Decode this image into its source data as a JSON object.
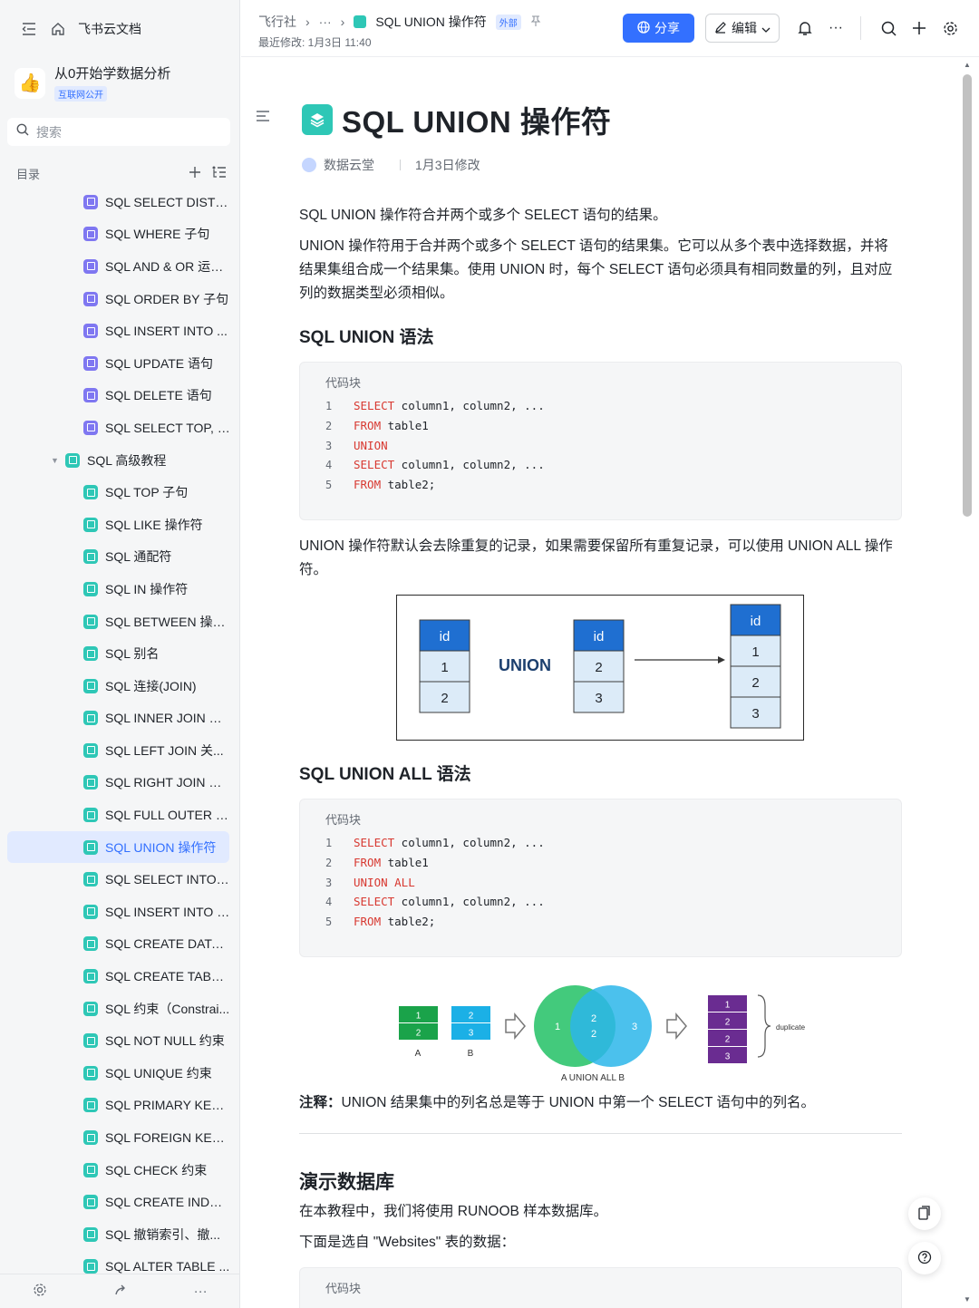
{
  "sidebar": {
    "brand": "飞书云文档",
    "space_name": "从0开始学数据分析",
    "space_badge": "互联网公开",
    "search_placeholder": "搜索",
    "toc_label": "目录",
    "items": [
      {
        "label": "SQL SELECT DISTIN...",
        "color": "purple"
      },
      {
        "label": "SQL WHERE 子句",
        "color": "purple"
      },
      {
        "label": "SQL AND & OR 运算...",
        "color": "purple"
      },
      {
        "label": "SQL ORDER BY 子句",
        "color": "purple"
      },
      {
        "label": "SQL INSERT INTO ...",
        "color": "purple"
      },
      {
        "label": "SQL UPDATE 语句",
        "color": "purple"
      },
      {
        "label": "SQL DELETE 语句",
        "color": "purple"
      },
      {
        "label": "SQL SELECT TOP, LI...",
        "color": "purple"
      },
      {
        "label": "SQL 高级教程",
        "color": "teal",
        "parent": true
      },
      {
        "label": "SQL TOP 子句",
        "color": "teal"
      },
      {
        "label": "SQL LIKE 操作符",
        "color": "teal"
      },
      {
        "label": "SQL 通配符",
        "color": "teal"
      },
      {
        "label": "SQL IN 操作符",
        "color": "teal"
      },
      {
        "label": "SQL BETWEEN 操作符",
        "color": "teal"
      },
      {
        "label": "SQL 别名",
        "color": "teal"
      },
      {
        "label": "SQL 连接(JOIN)",
        "color": "teal"
      },
      {
        "label": "SQL INNER JOIN 关...",
        "color": "teal"
      },
      {
        "label": "SQL LEFT JOIN 关...",
        "color": "teal"
      },
      {
        "label": "SQL RIGHT JOIN 关...",
        "color": "teal"
      },
      {
        "label": "SQL FULL OUTER J...",
        "color": "teal"
      },
      {
        "label": "SQL UNION 操作符",
        "color": "teal",
        "active": true
      },
      {
        "label": "SQL SELECT INTO ...",
        "color": "teal"
      },
      {
        "label": "SQL INSERT INTO S...",
        "color": "teal"
      },
      {
        "label": "SQL CREATE DATAB...",
        "color": "teal"
      },
      {
        "label": "SQL CREATE TABLE ...",
        "color": "teal"
      },
      {
        "label": "SQL 约束（Constrai...",
        "color": "teal"
      },
      {
        "label": "SQL NOT NULL 约束",
        "color": "teal"
      },
      {
        "label": "SQL UNIQUE 约束",
        "color": "teal"
      },
      {
        "label": "SQL PRIMARY KEY ...",
        "color": "teal"
      },
      {
        "label": "SQL FOREIGN KEY ...",
        "color": "teal"
      },
      {
        "label": "SQL CHECK 约束",
        "color": "teal"
      },
      {
        "label": "SQL CREATE INDEX ...",
        "color": "teal"
      },
      {
        "label": "SQL 撤销索引、撤...",
        "color": "teal"
      },
      {
        "label": "SQL ALTER TABLE ...",
        "color": "teal"
      }
    ]
  },
  "header": {
    "breadcrumb_root": "飞行社",
    "breadcrumb_more": "···",
    "breadcrumb_current": "SQL UNION 操作符",
    "external_tag": "外部",
    "last_modified": "最近修改: 1月3日 11:40",
    "share_label": "分享",
    "edit_label": "编辑"
  },
  "doc": {
    "title": "SQL UNION 操作符",
    "author": "数据云堂",
    "modified": "1月3日修改",
    "intro": "SQL UNION 操作符合并两个或多个 SELECT 语句的结果。",
    "para1": "UNION 操作符用于合并两个或多个 SELECT 语句的结果集。它可以从多个表中选择数据，并将结果集组合成一个结果集。使用 UNION 时，每个 SELECT 语句必须具有相同数量的列，且对应列的数据类型必须相似。",
    "h_syntax": "SQL UNION 语法",
    "code_label": "代码块",
    "code1": [
      {
        "n": "1",
        "kw": "SELECT",
        "rest": " column1, column2, ..."
      },
      {
        "n": "2",
        "kw": "FROM",
        "rest": " table1"
      },
      {
        "n": "3",
        "kw": "UNION",
        "rest": ""
      },
      {
        "n": "4",
        "kw": "SELECT",
        "rest": " column1, column2, ..."
      },
      {
        "n": "5",
        "kw": "FROM",
        "rest": " table2;"
      }
    ],
    "para2": "UNION 操作符默认会去除重复的记录，如果需要保留所有重复记录，可以使用 UNION ALL 操作符。",
    "h_syntax_all": "SQL UNION ALL 语法",
    "code2": [
      {
        "n": "1",
        "kw": "SELECT",
        "rest": " column1, column2, ..."
      },
      {
        "n": "2",
        "kw": "FROM",
        "rest": " table1"
      },
      {
        "n": "3",
        "kw": "UNION ALL",
        "rest": ""
      },
      {
        "n": "4",
        "kw": "SELECT",
        "rest": " column1, column2, ..."
      },
      {
        "n": "5",
        "kw": "FROM",
        "rest": " table2;"
      }
    ],
    "note_label": "注释：",
    "note": "UNION 结果集中的列名总是等于 UNION 中第一个 SELECT 语句中的列名。",
    "h_demo": "演示数据库",
    "demo_p1": "在本教程中，我们将使用 RUNOOB 样本数据库。",
    "demo_p2": "下面是选自 \"Websites\" 表的数据："
  },
  "diagram1": {
    "header": "id",
    "op": "UNION",
    "left": [
      "1",
      "2"
    ],
    "right": [
      "2",
      "3"
    ],
    "result": [
      "1",
      "2",
      "3"
    ],
    "color": "#1f6fd1"
  },
  "diagram2": {
    "a_vals": [
      "1",
      "2"
    ],
    "b_vals": [
      "2",
      "3"
    ],
    "a_label": "A",
    "b_label": "B",
    "venn_left": "1",
    "venn_mid1": "2",
    "venn_mid2": "2",
    "venn_right": "3",
    "venn_caption": "A UNION ALL B",
    "result": [
      "1",
      "2",
      "2",
      "3"
    ],
    "dup_label": "duplicate",
    "green": "#1aa34a",
    "blue": "#1bb0e6",
    "purple": "#6a2c91"
  }
}
